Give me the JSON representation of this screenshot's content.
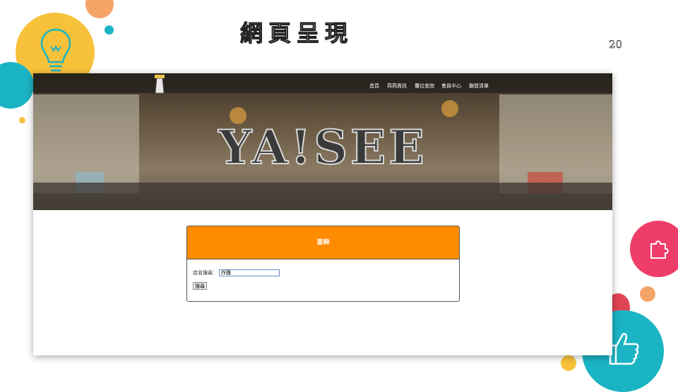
{
  "slide": {
    "title": "網頁呈現",
    "page_number": "20"
  },
  "site": {
    "brand": "YA!SEE",
    "nav": [
      "首頁",
      "燕燕資訊",
      "攤位查詢",
      "會員中心",
      "聯盟清單"
    ]
  },
  "search_panel": {
    "header": "查詢",
    "store_label": "店名搜尋：",
    "store_value": "炸雞",
    "search_button": "搜尋"
  },
  "colors": {
    "panel_header": "#ff8c00",
    "accent_teal": "#1bb4c4",
    "accent_yellow": "#f7c23a",
    "accent_pink": "#ef3d6a"
  }
}
